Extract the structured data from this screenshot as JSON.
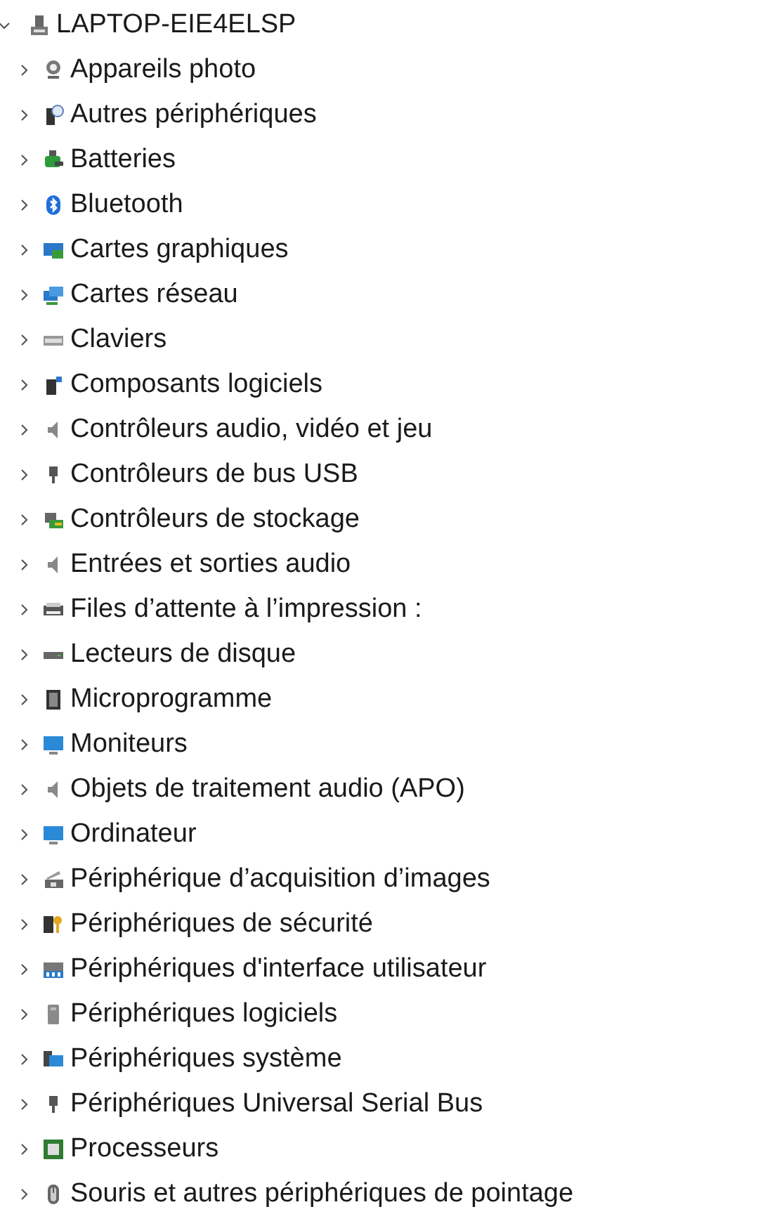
{
  "tree": {
    "label": "LAPTOP-EIE4ELSP",
    "kind": "computer",
    "expanded": true,
    "children": [
      {
        "label": "Appareils photo",
        "kind": "camera",
        "expanded": false
      },
      {
        "label": "Autres périphériques",
        "kind": "unknown",
        "expanded": false
      },
      {
        "label": "Batteries",
        "kind": "battery",
        "expanded": false
      },
      {
        "label": "Bluetooth",
        "kind": "bluetooth",
        "expanded": false
      },
      {
        "label": "Cartes graphiques",
        "kind": "display",
        "expanded": false
      },
      {
        "label": "Cartes réseau",
        "kind": "network",
        "expanded": false
      },
      {
        "label": "Claviers",
        "kind": "keyboard",
        "expanded": false
      },
      {
        "label": "Composants logiciels",
        "kind": "component",
        "expanded": false
      },
      {
        "label": "Contrôleurs audio, vidéo et jeu",
        "kind": "speaker",
        "expanded": false
      },
      {
        "label": "Contrôleurs de bus USB",
        "kind": "usb",
        "expanded": false
      },
      {
        "label": "Contrôleurs de stockage",
        "kind": "storage",
        "expanded": false
      },
      {
        "label": "Entrées et sorties audio",
        "kind": "speaker",
        "expanded": false
      },
      {
        "label": "Files d’attente à l’impression :",
        "kind": "printer",
        "expanded": false
      },
      {
        "label": "Lecteurs de disque",
        "kind": "disk",
        "expanded": false
      },
      {
        "label": "Microprogramme",
        "kind": "chip",
        "expanded": false
      },
      {
        "label": "Moniteurs",
        "kind": "monitor",
        "expanded": false
      },
      {
        "label": "Objets de traitement audio (APO)",
        "kind": "speaker",
        "expanded": false
      },
      {
        "label": "Ordinateur",
        "kind": "monitor",
        "expanded": false
      },
      {
        "label": "Périphérique d’acquisition d’images",
        "kind": "scanner",
        "expanded": false
      },
      {
        "label": "Périphériques de sécurité",
        "kind": "security",
        "expanded": false
      },
      {
        "label": "Périphériques d'interface utilisateur",
        "kind": "hid",
        "expanded": false
      },
      {
        "label": "Périphériques logiciels",
        "kind": "software",
        "expanded": false
      },
      {
        "label": "Périphériques système",
        "kind": "system",
        "expanded": false
      },
      {
        "label": "Périphériques Universal Serial Bus",
        "kind": "usb",
        "expanded": false
      },
      {
        "label": "Processeurs",
        "kind": "processor",
        "expanded": false
      },
      {
        "label": "Souris et autres périphériques de pointage",
        "kind": "mouse",
        "expanded": false
      }
    ]
  }
}
